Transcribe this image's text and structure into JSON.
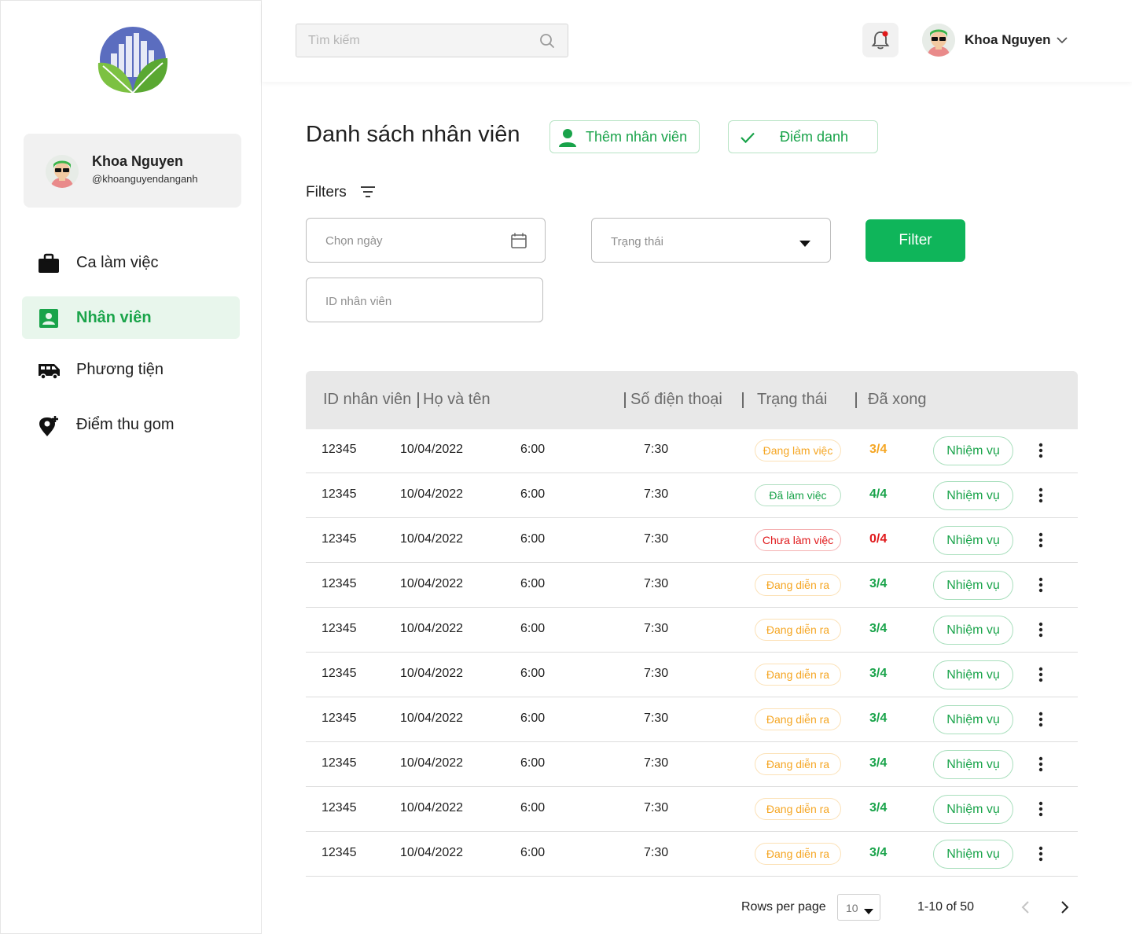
{
  "search": {
    "placeholder": "Tìm kiếm"
  },
  "user": {
    "name": "Khoa Nguyen",
    "handle": "@khoanguyendanganh"
  },
  "sidebar": {
    "items": [
      {
        "label": "Ca làm việc",
        "icon": "briefcase-icon"
      },
      {
        "label": "Nhân viên",
        "icon": "contact-card-icon",
        "active": true
      },
      {
        "label": "Phương tiện",
        "icon": "van-icon"
      },
      {
        "label": "Điểm thu gom",
        "icon": "add-location-icon"
      }
    ]
  },
  "page": {
    "title": "Danh sách nhân viên",
    "add_button": "Thêm nhân viên",
    "attend_button": "Điểm danh"
  },
  "filters": {
    "label": "Filters",
    "date_placeholder": "Chọn ngày",
    "status_placeholder": "Trạng thái",
    "id_placeholder": "ID nhân viên",
    "button": "Filter"
  },
  "table": {
    "headers": [
      "ID nhân viên",
      "Họ và tên",
      "Số điện thoại",
      "Trạng thái",
      "Đã xong"
    ],
    "task_label": "Nhiệm vụ",
    "rows": [
      {
        "id": "12345",
        "date": "10/04/2022",
        "start": "6:00",
        "end": "7:30",
        "status": "Đang làm việc",
        "done": "3/4",
        "status_color": "#f5a623",
        "done_color": "#f5a623"
      },
      {
        "id": "12345",
        "date": "10/04/2022",
        "start": "6:00",
        "end": "7:30",
        "status": "Đã làm việc",
        "done": "4/4",
        "status_color": "#19a34a",
        "done_color": "#19a34a"
      },
      {
        "id": "12345",
        "date": "10/04/2022",
        "start": "6:00",
        "end": "7:30",
        "status": "Chưa làm việc",
        "done": "0/4",
        "status_color": "#e0191b",
        "done_color": "#e0191b"
      },
      {
        "id": "12345",
        "date": "10/04/2022",
        "start": "6:00",
        "end": "7:30",
        "status": "Đang diễn ra",
        "done": "3/4",
        "status_color": "#f5a623",
        "done_color": "#19a34a"
      },
      {
        "id": "12345",
        "date": "10/04/2022",
        "start": "6:00",
        "end": "7:30",
        "status": "Đang diễn ra",
        "done": "3/4",
        "status_color": "#f5a623",
        "done_color": "#19a34a"
      },
      {
        "id": "12345",
        "date": "10/04/2022",
        "start": "6:00",
        "end": "7:30",
        "status": "Đang diễn ra",
        "done": "3/4",
        "status_color": "#f5a623",
        "done_color": "#19a34a"
      },
      {
        "id": "12345",
        "date": "10/04/2022",
        "start": "6:00",
        "end": "7:30",
        "status": "Đang diễn ra",
        "done": "3/4",
        "status_color": "#f5a623",
        "done_color": "#19a34a"
      },
      {
        "id": "12345",
        "date": "10/04/2022",
        "start": "6:00",
        "end": "7:30",
        "status": "Đang diễn ra",
        "done": "3/4",
        "status_color": "#f5a623",
        "done_color": "#19a34a"
      },
      {
        "id": "12345",
        "date": "10/04/2022",
        "start": "6:00",
        "end": "7:30",
        "status": "Đang diễn ra",
        "done": "3/4",
        "status_color": "#f5a623",
        "done_color": "#19a34a"
      },
      {
        "id": "12345",
        "date": "10/04/2022",
        "start": "6:00",
        "end": "7:30",
        "status": "Đang diễn ra",
        "done": "3/4",
        "status_color": "#f5a623",
        "done_color": "#19a34a"
      }
    ]
  },
  "pagination": {
    "rows_per_page_label": "Rows per page",
    "rows_per_page": "10",
    "range": "1-10 of 50"
  },
  "colors": {
    "accent": "#0fb55a",
    "brand_green": "#19a34a",
    "warning": "#f5a623",
    "danger": "#e0191b"
  }
}
